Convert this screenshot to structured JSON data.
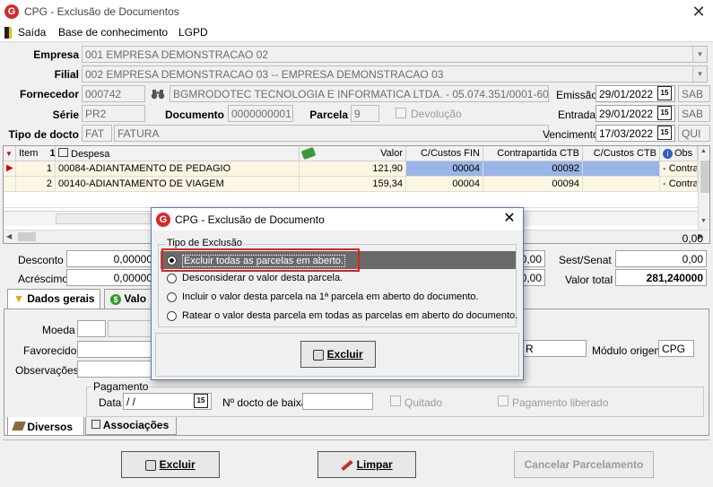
{
  "window": {
    "title": "CPG - Exclusão de Documentos",
    "icon_glyph": "G"
  },
  "menu": {
    "items": [
      "Saída",
      "Base de conhecimento",
      "LGPD"
    ]
  },
  "form": {
    "empresa_label": "Empresa",
    "empresa_value": "001 EMPRESA DEMONSTRACAO 02",
    "filial_label": "Filial",
    "filial_value": "002 EMPRESA DEMONSTRACAO 03 -- EMPRESA DEMONSTRACAO 03",
    "fornecedor_label": "Fornecedor",
    "fornecedor_code": "000742",
    "fornecedor_name": "BGMRODOTEC TECNOLOGIA E INFORMATICA LTDA. - 05.074.351/0001-60",
    "emissao_label": "Emissão",
    "emissao_value": "29/01/2022",
    "emissao_day": "SAB",
    "serie_label": "Série",
    "serie_value": "PR2",
    "documento_label": "Documento",
    "documento_value": "0000000001",
    "parcela_label": "Parcela",
    "parcela_value": "9",
    "devolucao_label": "Devolução",
    "entrada_label": "Entrada",
    "entrada_value": "29/01/2022",
    "entrada_day": "SAB",
    "tipo_label": "Tipo de docto",
    "tipo_code": "FAT",
    "tipo_name": "FATURA",
    "vencimento_label": "Vencimento",
    "vencimento_value": "17/03/2022",
    "vencimento_day": "QUI"
  },
  "grid": {
    "headers": {
      "item": "Item",
      "sort": "1",
      "despesa": "Despesa",
      "valor": "Valor",
      "ccfin": "C/Custos FIN",
      "contra": "Contrapartida CTB",
      "ccctb": "C/Custos CTB",
      "obs": "Obs"
    },
    "rows": [
      {
        "item": "1",
        "despesa": "00084-ADIANTAMENTO DE PEDAGIO",
        "valor": "121,90",
        "ccfin": "00004",
        "contra": "00092",
        "ccctb": "",
        "obs": "- Contra"
      },
      {
        "item": "2",
        "despesa": "00140-ADIANTAMENTO DE VIAGEM",
        "valor": "159,34",
        "ccfin": "00004",
        "contra": "00094",
        "ccctb": "",
        "obs": "- Contra"
      }
    ]
  },
  "totals": {
    "desconto_label": "Desconto",
    "desconto_value": "0,00000",
    "acrescimo_label": "Acréscimo",
    "acrescimo_value": "0,00000",
    "mid_value": "0,00",
    "right_value": "0,00",
    "mid_value2": "0,00",
    "sest_label": "Sest/Senat",
    "sest_value": "0,00",
    "valor_total_label": "Valor total",
    "valor_total_value": "281,240000"
  },
  "tabs": {
    "dados_gerais": "Dados gerais",
    "valores": "Valo"
  },
  "details": {
    "moeda_label": "Moeda",
    "favorecido_label": "Favorecido",
    "observacoes_label": "Observações",
    "modulo_label": "Módulo origem",
    "modulo_value": "CPG",
    "hidden_suffix": "R",
    "pagamento_legend": "Pagamento",
    "data_label": "Data",
    "data_value": " /  /",
    "ndocto_label": "Nº docto de baixa",
    "quitado_label": "Quitado",
    "pago_label": "Pagamento liberado"
  },
  "bottom_tabs": {
    "diversos": "Diversos",
    "associacoes": "Associações"
  },
  "buttons": {
    "excluir": "Excluir",
    "limpar": "Limpar",
    "cancelar": "Cancelar Parcelamento"
  },
  "dialog": {
    "title": "CPG - Exclusão de Documento",
    "group_label": "Tipo de Exclusão",
    "options": [
      "Excluir todas as parcelas em aberto.",
      "Desconsiderar o valor desta  parcela.",
      "Incluir o valor desta parcela na 1ª parcela em aberto do documento.",
      "Ratear o valor desta parcela em todas as parcelas em aberto do documento."
    ],
    "selected_index": 0,
    "excluir_button": "Excluir"
  },
  "colors": {
    "accent_selection": "#6a6a6a",
    "highlight_box": "#e02020",
    "grid_selected": "#99b4e6",
    "row_alt": "#fdf6e3"
  }
}
